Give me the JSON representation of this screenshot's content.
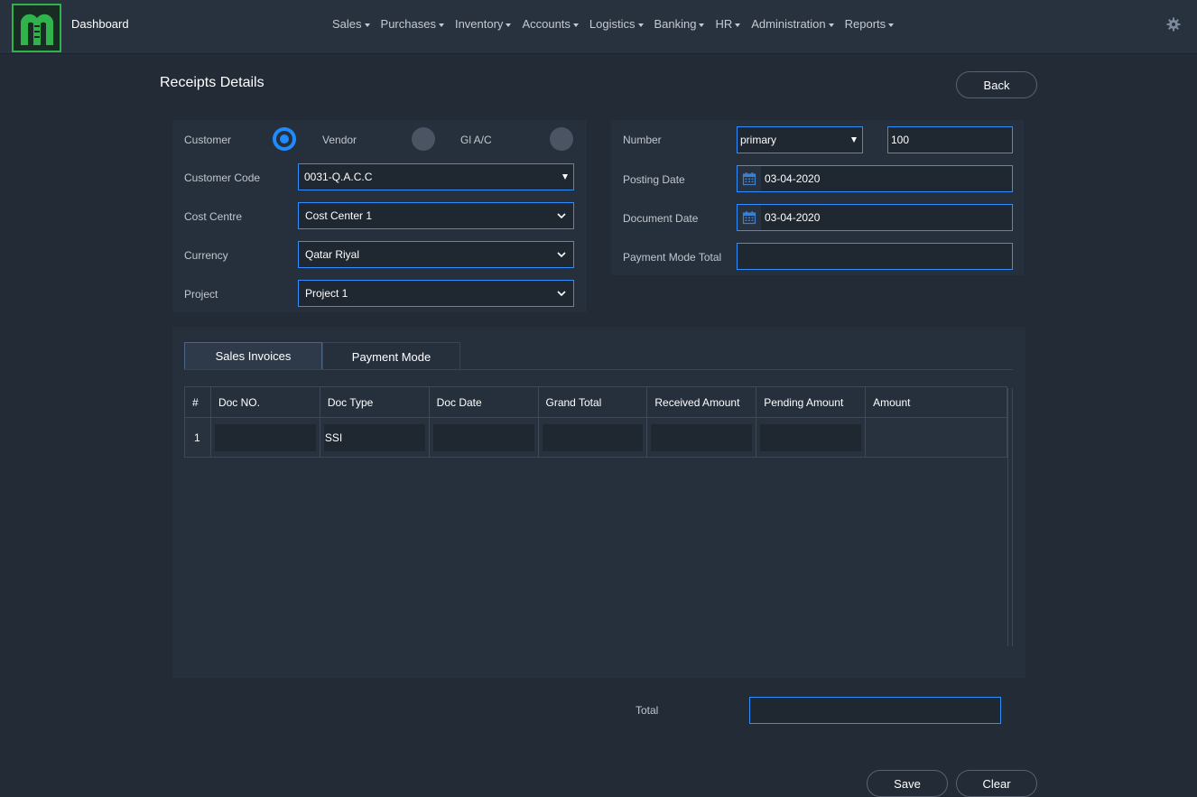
{
  "header": {
    "dashboard": "Dashboard",
    "nav": [
      "Sales",
      "Purchases",
      "Inventory",
      "Accounts",
      "Logistics",
      "Banking",
      "HR",
      "Administration",
      "Reports"
    ],
    "brand_color": "#2fb34a",
    "accent_color": "#1f8bff"
  },
  "page": {
    "title": "Receipts Details",
    "back_label": "Back"
  },
  "left_form": {
    "type_options": [
      {
        "label": "Customer",
        "selected": true
      },
      {
        "label": "Vendor",
        "selected": false
      },
      {
        "label": "Gl A/C",
        "selected": false
      }
    ],
    "customer_code": {
      "label": "Customer Code",
      "value": "0031-Q.A.C.C"
    },
    "cost_centre": {
      "label": "Cost Centre",
      "value": "Cost Center 1"
    },
    "currency": {
      "label": "Currency",
      "value": "Qatar Riyal"
    },
    "project": {
      "label": "Project",
      "value": "Project 1"
    }
  },
  "right_form": {
    "number": {
      "label": "Number",
      "series": "primary",
      "value": "100"
    },
    "posting_date": {
      "label": "Posting Date",
      "value": "03-04-2020"
    },
    "document_date": {
      "label": "Document Date",
      "value": "03-04-2020"
    },
    "payment_mode_total": {
      "label": "Payment Mode Total",
      "value": ""
    }
  },
  "tabs": [
    {
      "label": "Sales Invoices",
      "active": true
    },
    {
      "label": "Payment Mode",
      "active": false
    }
  ],
  "table": {
    "columns": [
      "#",
      "Doc NO.",
      "Doc Type",
      "Doc Date",
      "Grand Total",
      "Received Amount",
      "Pending Amount",
      "Amount"
    ],
    "rows": [
      {
        "index": "1",
        "doc_no": "",
        "doc_type": "SSI",
        "doc_date": "",
        "grand_total": "",
        "received_amount": "",
        "pending_amount": "",
        "amount": ""
      }
    ]
  },
  "footer": {
    "total_label": "Total",
    "total_value": "",
    "save_label": "Save",
    "clear_label": "Clear"
  }
}
